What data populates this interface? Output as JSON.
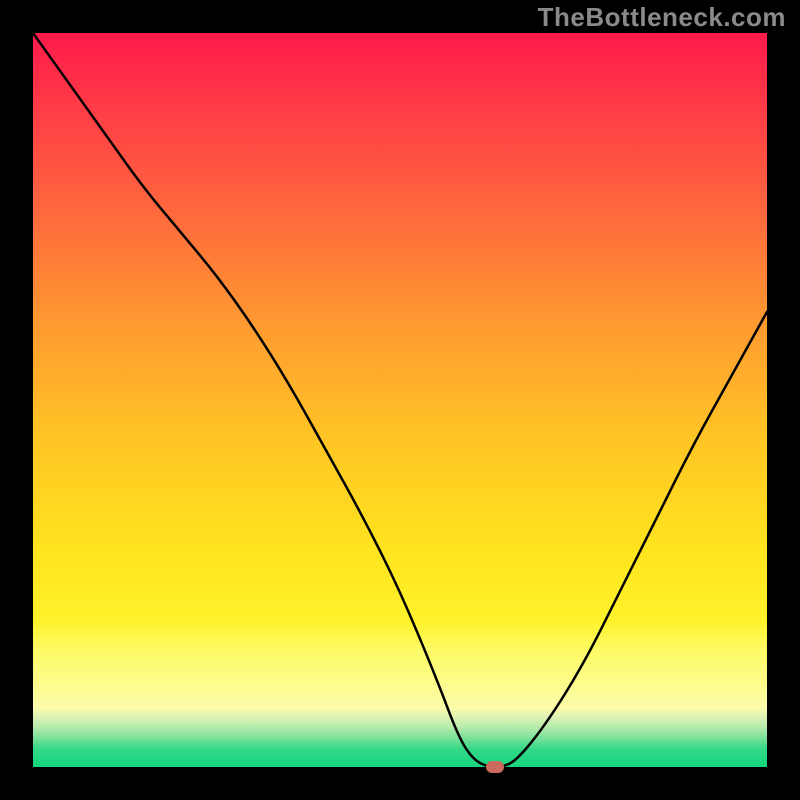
{
  "watermark": "TheBottleneck.com",
  "chart_data": {
    "type": "line",
    "title": "",
    "xlabel": "",
    "ylabel": "",
    "xlim": [
      0,
      100
    ],
    "ylim": [
      0,
      100
    ],
    "x": [
      0,
      5,
      10,
      15,
      20,
      25,
      30,
      35,
      40,
      45,
      50,
      55,
      58,
      60,
      62,
      64,
      66,
      70,
      75,
      80,
      85,
      90,
      95,
      100
    ],
    "values": [
      100,
      93,
      86,
      79,
      73,
      67,
      60,
      52,
      43,
      34,
      24,
      12,
      4,
      1,
      0,
      0,
      1,
      6,
      14,
      24,
      34,
      44,
      53,
      62
    ],
    "marker": {
      "x": 63,
      "y": 0
    },
    "background_gradient": {
      "top": "#ff1a4a",
      "mid": "#ffe31f",
      "bottom": "#14d57e"
    }
  }
}
